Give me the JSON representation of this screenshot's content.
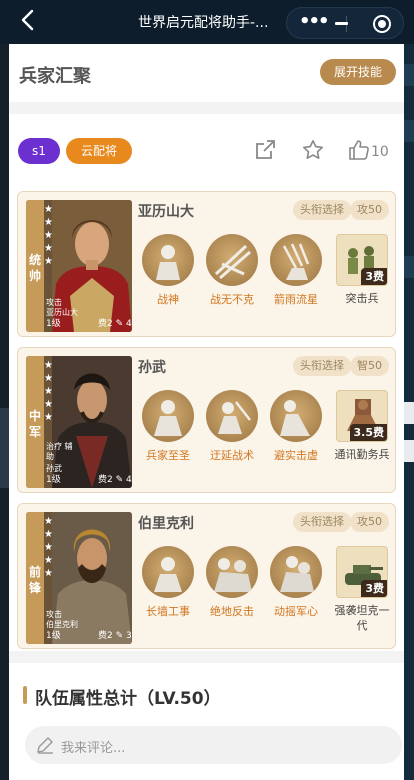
{
  "nav": {
    "back": "‹",
    "title": "世界启元配将助手-..."
  },
  "header": {
    "title": "兵家汇聚",
    "expand_label": "展开技能"
  },
  "tags": {
    "season": "s1",
    "cloud": "云配将"
  },
  "actions": {
    "like_count": "10"
  },
  "heroes": [
    {
      "role": "统帅",
      "name": "亚历山大",
      "mini_type": "攻击",
      "mini_name": "亚历山大",
      "level": "1级",
      "cost": "费2",
      "extra": "4",
      "badge_title": "头衔选择",
      "badge_type": "攻50",
      "skills": [
        "战神",
        "战无不克",
        "箭雨流星"
      ],
      "troop_cost": "3费",
      "troop_name": "突击兵"
    },
    {
      "role": "中军",
      "name": "孙武",
      "mini_type": "治疗 辅助",
      "mini_name": "孙武",
      "level": "1级",
      "cost": "费2",
      "extra": "4",
      "badge_title": "头衔选择",
      "badge_type": "智50",
      "skills": [
        "兵家至圣",
        "迂延战术",
        "避实击虚"
      ],
      "troop_cost": "3.5费",
      "troop_name": "通讯勤务兵"
    },
    {
      "role": "前锋",
      "name": "伯里克利",
      "mini_type": "攻击",
      "mini_name": "伯里克利",
      "level": "1级",
      "cost": "费2",
      "extra": "3",
      "badge_title": "头衔选择",
      "badge_type": "攻50",
      "skills": [
        "长墙工事",
        "绝地反击",
        "动摇军心"
      ],
      "troop_cost": "3费",
      "troop_name": "强袭坦克一代"
    }
  ],
  "summary": {
    "title": "队伍属性总计（LV.50）"
  },
  "comment": {
    "placeholder": "我来评论..."
  },
  "colors": {
    "accent_gold": "#b98a4e",
    "season_purple": "#6c2fd0",
    "cloud_orange": "#e8891e",
    "skill_text": "#d2761f"
  }
}
